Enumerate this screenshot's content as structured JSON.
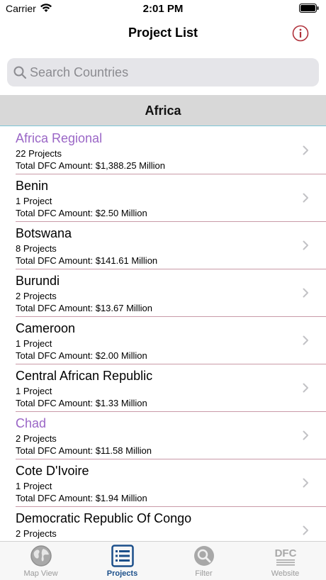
{
  "status": {
    "carrier": "Carrier",
    "time": "2:01 PM"
  },
  "nav": {
    "title": "Project List"
  },
  "search": {
    "placeholder": "Search Countries",
    "value": ""
  },
  "section": {
    "title": "Africa"
  },
  "rows": [
    {
      "name": "Africa Regional",
      "count": "22 Projects",
      "amount": "Total DFC Amount: $1,388.25 Million",
      "highlighted": true
    },
    {
      "name": "Benin",
      "count": "1 Project",
      "amount": "Total DFC Amount: $2.50 Million",
      "highlighted": false
    },
    {
      "name": "Botswana",
      "count": "8 Projects",
      "amount": "Total DFC Amount: $141.61 Million",
      "highlighted": false
    },
    {
      "name": "Burundi",
      "count": "2 Projects",
      "amount": "Total DFC Amount: $13.67 Million",
      "highlighted": false
    },
    {
      "name": "Cameroon",
      "count": "1 Project",
      "amount": "Total DFC Amount: $2.00 Million",
      "highlighted": false
    },
    {
      "name": "Central African Republic",
      "count": "1 Project",
      "amount": "Total DFC Amount: $1.33 Million",
      "highlighted": false
    },
    {
      "name": "Chad",
      "count": "2 Projects",
      "amount": "Total DFC Amount: $11.58 Million",
      "highlighted": true
    },
    {
      "name": "Cote D'Ivoire",
      "count": "1 Project",
      "amount": "Total DFC Amount: $1.94 Million",
      "highlighted": false
    },
    {
      "name": "Democratic Republic Of Congo",
      "count": "2 Projects",
      "amount": "",
      "highlighted": false
    }
  ],
  "tabs": [
    {
      "label": "Map View",
      "icon": "globe-icon",
      "active": false
    },
    {
      "label": "Projects",
      "icon": "list-icon",
      "active": true
    },
    {
      "label": "Filter",
      "icon": "magnifier-icon",
      "active": false
    },
    {
      "label": "Website",
      "icon": "dfc-logo-icon",
      "active": false
    }
  ],
  "colors": {
    "accent": "#9a66c6",
    "active_tab": "#1b4f8a",
    "info": "#b0303a",
    "separator": "#c99aa8"
  }
}
